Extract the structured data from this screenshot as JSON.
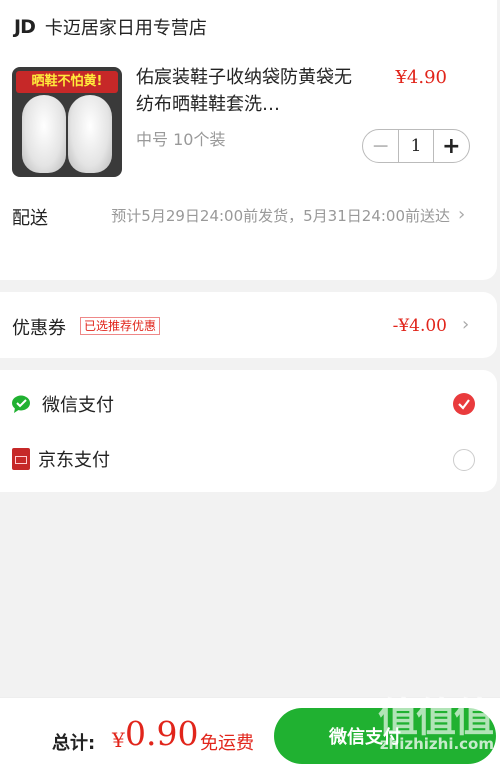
{
  "store": {
    "logo": "JD",
    "name": "卡迈居家日用专营店"
  },
  "product": {
    "image_banner": "晒鞋不怕黄!",
    "title": "佑宸装鞋子收纳袋防黄袋无纺布晒鞋鞋套洗…",
    "price": "¥4.90",
    "spec": "中号 10个装",
    "quantity": "1",
    "minus_symbol": "−",
    "plus_symbol": "+"
  },
  "delivery": {
    "label": "配送",
    "text": "预计5月29日24:00前发货，5月31日24:00前送达"
  },
  "coupon": {
    "label": "优惠券",
    "tag": "已选推荐优惠",
    "value": "-¥4.00"
  },
  "payment": {
    "methods": [
      {
        "label": "微信支付",
        "icon": "wechat-pay-icon",
        "selected": true
      },
      {
        "label": "京东支付",
        "icon": "jd-pay-icon",
        "selected": false
      }
    ]
  },
  "footer": {
    "total_label": "总计:",
    "currency": "¥",
    "total_amount": "0.90",
    "shipping_note": "免运费",
    "pay_button_label": "微信支付"
  },
  "watermark": {
    "logo": "值值值",
    "site": "zhizhizhi.com"
  },
  "colors": {
    "price_red": "#e1251b",
    "wechat_green": "#20b131",
    "selected_red": "#e93b3d",
    "background": "#f2f2f2"
  }
}
